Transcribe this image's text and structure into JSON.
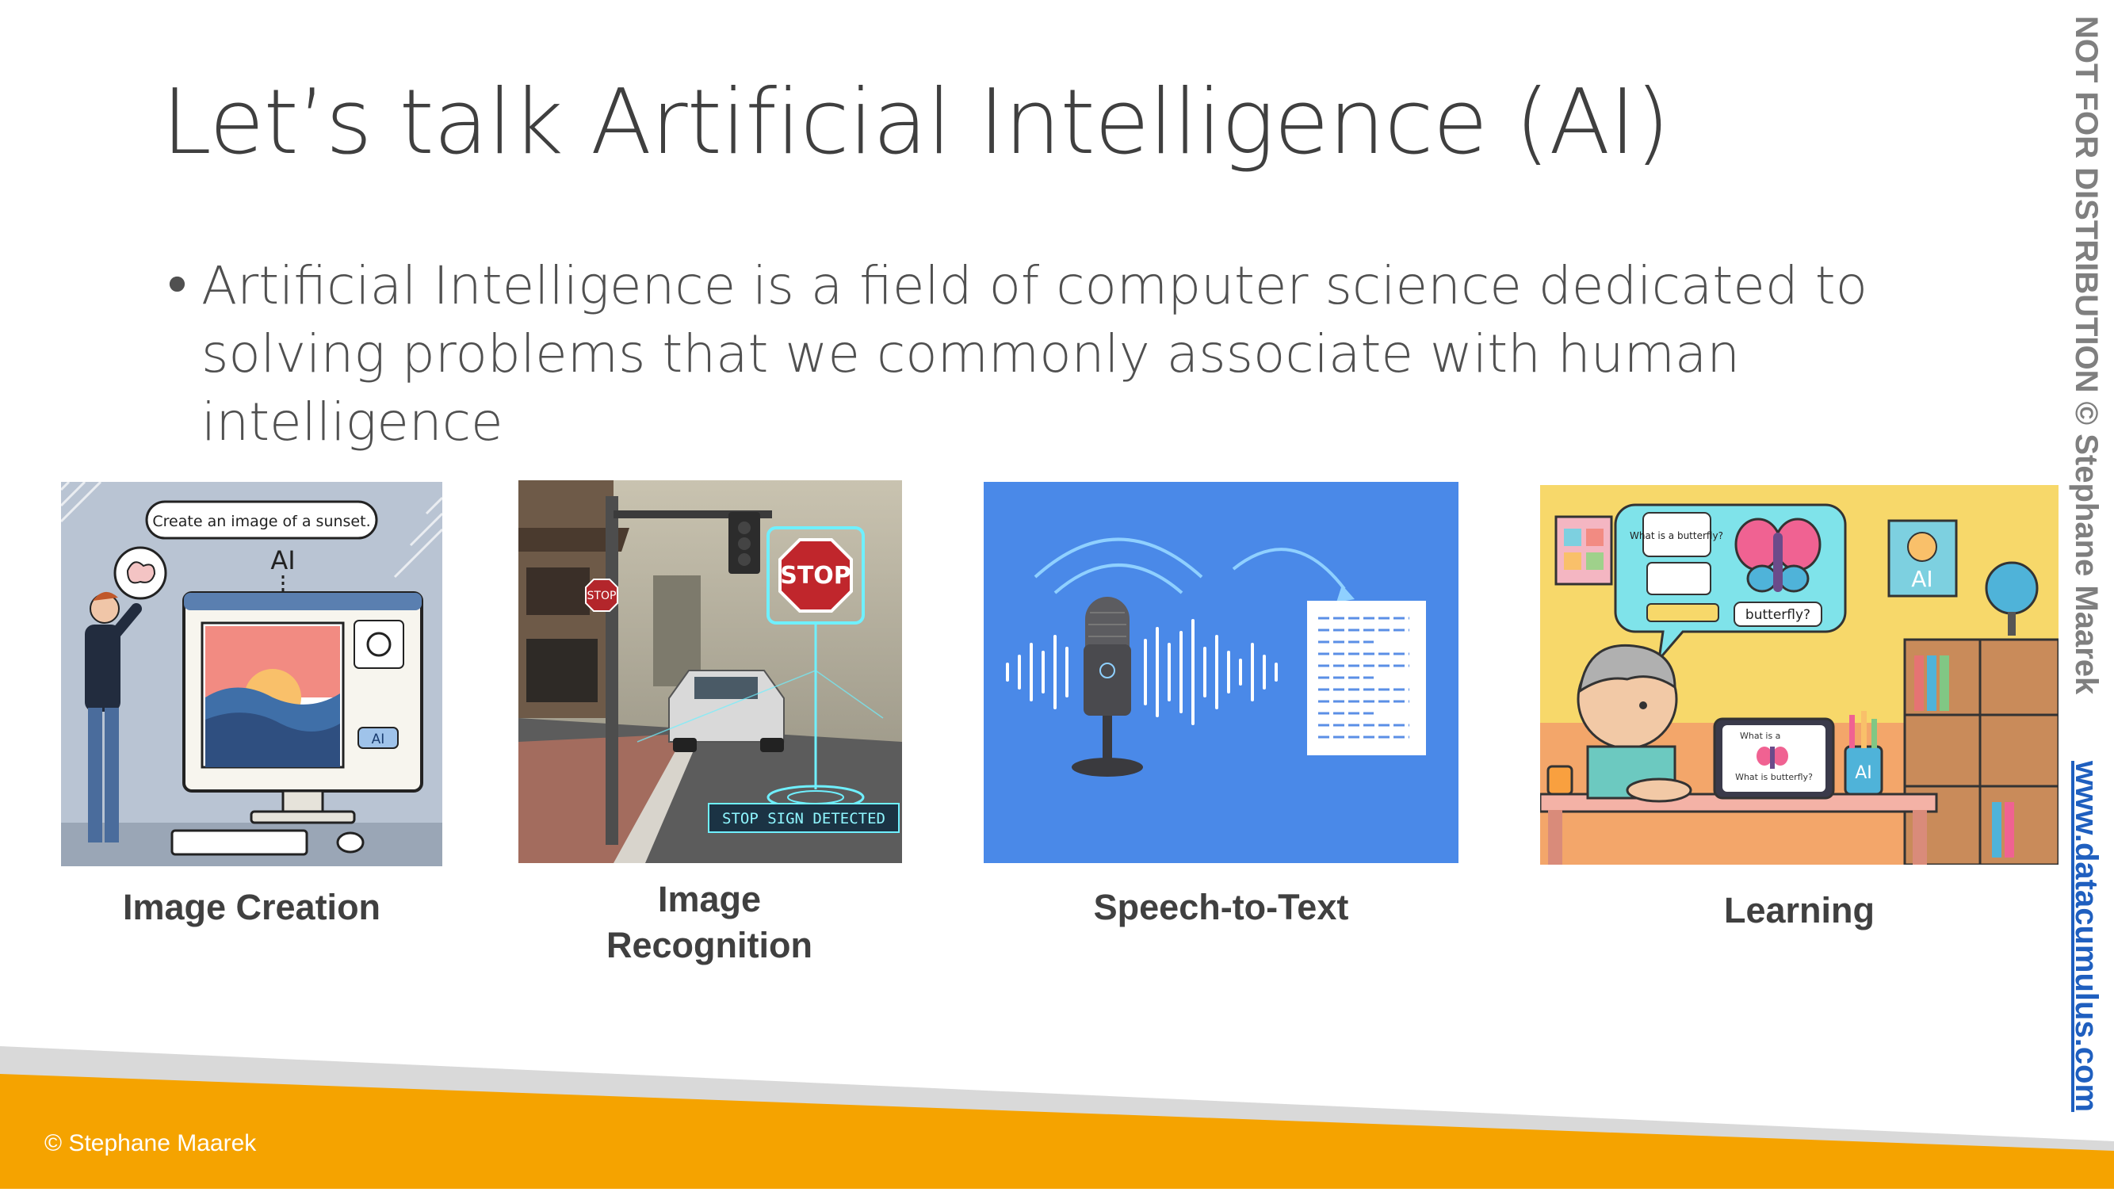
{
  "slide": {
    "title": "Let’s talk Artificial Intelligence (AI)",
    "bullet_marker": "•",
    "bullet": "Artificial Intelligence is a field of computer science dedicated to solving problems that we commonly associate with human intelligence",
    "watermark_vertical": "NOT FOR DISTRIBUTION © Stephane Maarek",
    "watermark_site": "www.datacumulus.com",
    "footer_copyright": "© Stephane Maarek"
  },
  "tiles": [
    {
      "caption": "Image Creation",
      "prompt": "Create an image of a sunset.",
      "ai_label": "AI",
      "badge": "AI"
    },
    {
      "caption": "Image Recognition",
      "sign_text": "STOP",
      "detected_text": "STOP SIGN DETECTED"
    },
    {
      "caption": "Speech-to-Text"
    },
    {
      "caption": "Learning",
      "bubble_question": "What is a butterfly?",
      "butterfly_label": "butterfly?",
      "ai_label": "AI",
      "tablet_top": "What is a",
      "tablet_bottom": "What is butterfly?",
      "jar_label": "AI"
    }
  ],
  "colors": {
    "speech_bg": "#4a89e8",
    "footer_orange": "#f5a300",
    "footer_gray": "#d9d9d9",
    "link_blue": "#1f5fbf"
  }
}
